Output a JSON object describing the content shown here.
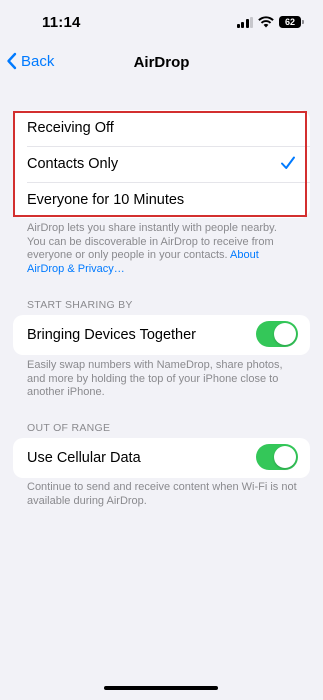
{
  "status": {
    "time": "11:14",
    "battery": "62"
  },
  "nav": {
    "back_label": "Back",
    "title": "AirDrop"
  },
  "receiving": {
    "options": [
      {
        "label": "Receiving Off",
        "selected": false
      },
      {
        "label": "Contacts Only",
        "selected": true
      },
      {
        "label": "Everyone for 10 Minutes",
        "selected": false
      }
    ],
    "footnote_text": "AirDrop lets you share instantly with people nearby. You can be discoverable in AirDrop to receive from everyone or only people in your contacts. ",
    "footnote_link": "About AirDrop & Privacy…"
  },
  "start_sharing": {
    "header": "START SHARING BY",
    "toggle_label": "Bringing Devices Together",
    "toggle_on": true,
    "footnote": "Easily swap numbers with NameDrop, share photos, and more by holding the top of your iPhone close to another iPhone."
  },
  "out_of_range": {
    "header": "OUT OF RANGE",
    "toggle_label": "Use Cellular Data",
    "toggle_on": true,
    "footnote": "Continue to send and receive content when Wi-Fi is not available during AirDrop."
  },
  "colors": {
    "accent": "#007aff",
    "toggle_on": "#34c759",
    "highlight_border": "#d32f2f",
    "background": "#f2f2f7"
  }
}
